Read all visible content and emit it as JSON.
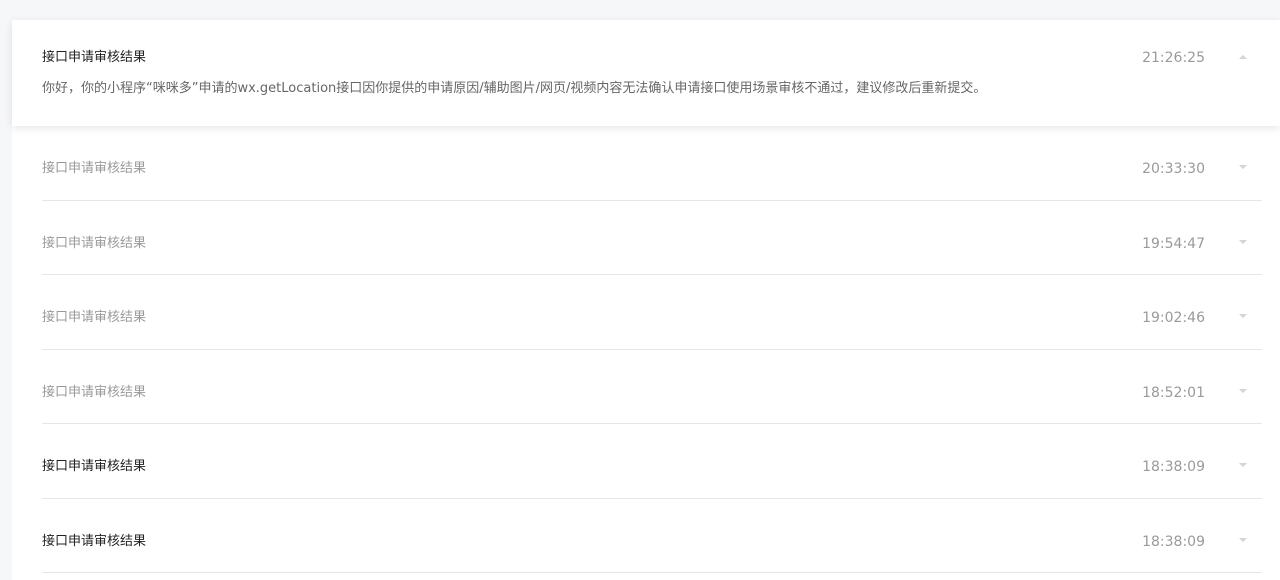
{
  "messages": [
    {
      "title": "接口申请审核结果",
      "time": "21:26:25",
      "expanded": true,
      "content": "你好，你的小程序“咪咪多”申请的wx.getLocation接口因你提供的申请原因/辅助图片/网页/视频内容无法确认申请接口使用场景审核不通过，建议修改后重新提交。"
    },
    {
      "title": "接口申请审核结果",
      "time": "20:33:30",
      "read": true
    },
    {
      "title": "接口申请审核结果",
      "time": "19:54:47",
      "read": true
    },
    {
      "title": "接口申请审核结果",
      "time": "19:02:46",
      "read": true
    },
    {
      "title": "接口申请审核结果",
      "time": "18:52:01",
      "read": true
    },
    {
      "title": "接口申请审核结果",
      "time": "18:38:09",
      "read": false
    },
    {
      "title": "接口申请审核结果",
      "time": "18:38:09",
      "read": false
    }
  ],
  "icons": {
    "expanded": "chevron-up-icon",
    "collapsed": "chevron-down-icon"
  },
  "colors": {
    "page_background": "#f6f7f9",
    "panel_background": "#ffffff",
    "title_unread": "#222222",
    "title_read": "#9a9a9a",
    "time": "#9a9a9a",
    "content": "#666666",
    "divider": "#e6e6e6",
    "arrow": "#d4d4d4"
  }
}
